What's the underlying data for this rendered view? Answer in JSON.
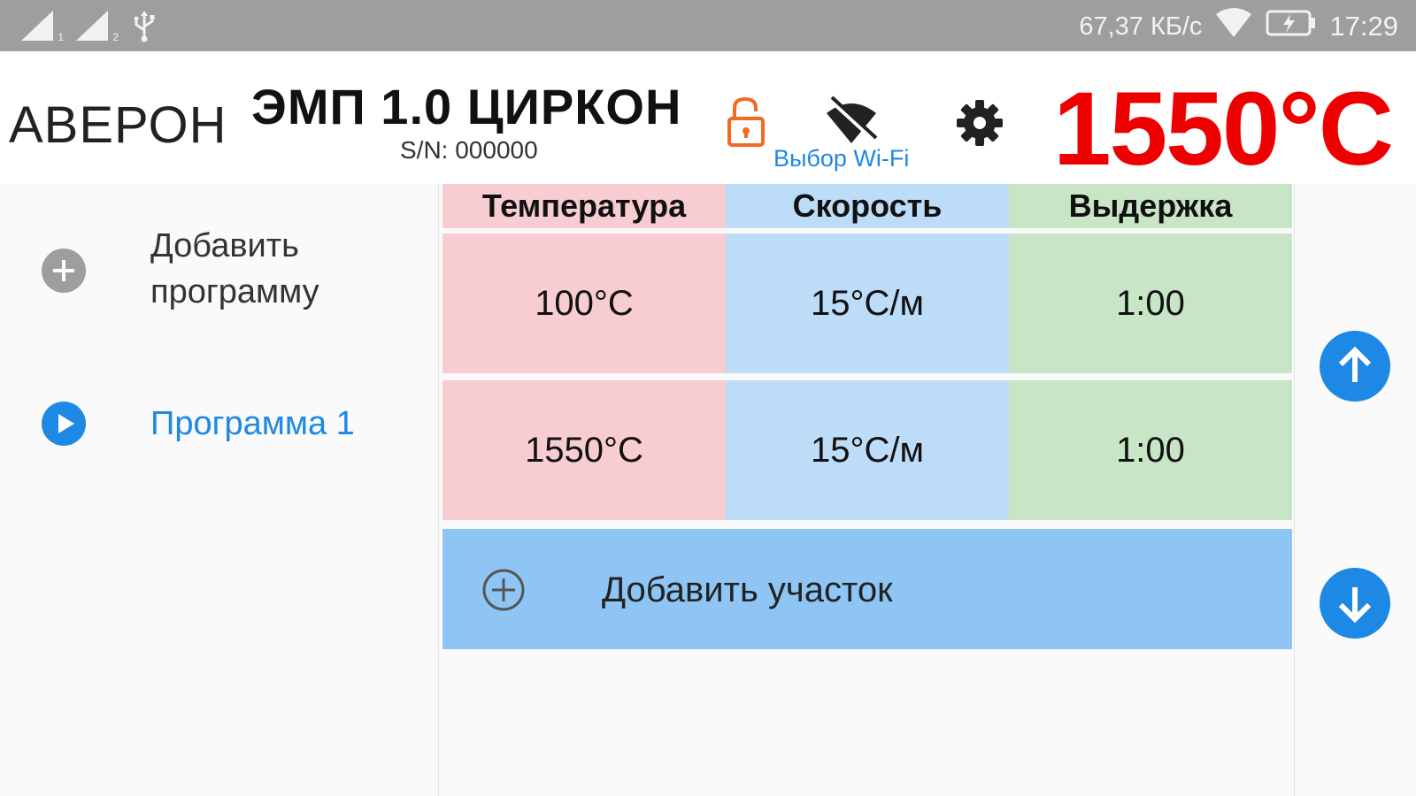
{
  "status_bar": {
    "sim1": "1",
    "sim2": "2",
    "speed": "67,37 КБ/с",
    "time": "17:29",
    "icons": [
      "signal-icon",
      "signal-icon",
      "usb-icon",
      "wifi-icon",
      "battery-charging-icon"
    ]
  },
  "header": {
    "brand": "АВЕРОН",
    "model": "ЭМП 1.0 ЦИРКОН",
    "serial": "S/N: 000000",
    "wifi_label": "Выбор Wi-Fi",
    "current_temp": "1550°С",
    "colors": {
      "temp": "#ee0000",
      "lock": "#f26a21",
      "accent": "#1e88e5"
    }
  },
  "sidebar": {
    "add_program": "Добавить программу",
    "programs": [
      {
        "label": "Программа 1",
        "selected": true
      }
    ]
  },
  "table": {
    "headers": [
      "Температура",
      "Скорость",
      "Выдержка"
    ],
    "rows": [
      [
        "100°С",
        "15°С/м",
        "1:00"
      ],
      [
        "1550°С",
        "15°С/м",
        "1:00"
      ]
    ],
    "add_section": "Добавить участок",
    "colors": {
      "temperature": "#f8cdd1",
      "speed": "#bcdcf8",
      "hold": "#c8e6c6",
      "add": "#8ec5f5"
    }
  }
}
